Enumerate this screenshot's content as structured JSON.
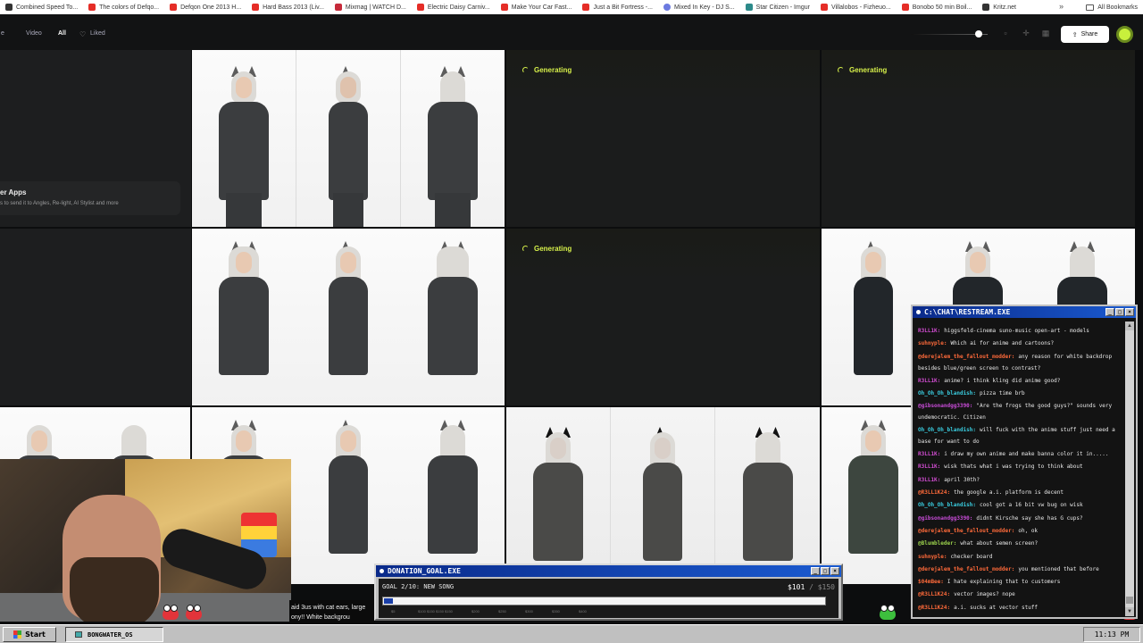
{
  "bookmarks": [
    {
      "label": "Combined Speed To...",
      "icon": "generic-icon"
    },
    {
      "label": "The colors of Defqo...",
      "icon": "youtube-icon"
    },
    {
      "label": "Defqon One 2013 H...",
      "icon": "youtube-icon"
    },
    {
      "label": "Hard Bass 2013 (Liv...",
      "icon": "youtube-icon"
    },
    {
      "label": "Mixmag | WATCH D...",
      "icon": "mixmag-icon"
    },
    {
      "label": "Electric Daisy Carniv...",
      "icon": "youtube-icon"
    },
    {
      "label": "Make Your Car Fast...",
      "icon": "youtube-icon"
    },
    {
      "label": "Just a Bit Fortress -...",
      "icon": "youtube-icon"
    },
    {
      "label": "Mixed In Key - DJ S...",
      "icon": "mixedinkey-icon"
    },
    {
      "label": "Star Citizen - Imgur",
      "icon": "imgur-icon"
    },
    {
      "label": "Villalobos - Fizheuo...",
      "icon": "youtube-icon"
    },
    {
      "label": "Bonobo 50 min Boil...",
      "icon": "youtube-icon"
    },
    {
      "label": "Kritz.net",
      "icon": "generic-icon"
    }
  ],
  "bookmarks_more": "»",
  "all_bookmarks": "All Bookmarks",
  "tabs": {
    "partial": "e",
    "video": "Video",
    "all": "All",
    "liked": "Liked"
  },
  "share_label": "Share",
  "generating_label": "Generating",
  "other_apps": {
    "title": "er Apps",
    "subtitle": "s to send it to Angles, Re-light, AI Stylist and more"
  },
  "caption": {
    "line1": "aid 3us with cat ears, large",
    "line2": "ony!! White backgrou"
  },
  "chat": {
    "title": "C:\\CHAT\\RESTREAM.EXE",
    "messages": [
      {
        "user": "R3LL1K:",
        "text": "higgsfeld-cinema suno-music open-art - models",
        "color": "#d04cd0"
      },
      {
        "user": "suhnyple:",
        "text": "Which ai for anime and cartoons?",
        "color": "#ff6a3a"
      },
      {
        "user": "@derejalem_the_fallout_modder:",
        "text": "any reason for white backdrop besides blue/green screen to contrast?",
        "color": "#ff6a3a",
        "wrap": true
      },
      {
        "user": "R3LL1K:",
        "text": "anime? i think kling did anime good?",
        "color": "#d04cd0"
      },
      {
        "user": "Oh_Oh_Oh_blandish:",
        "text": "pizza time brb",
        "color": "#3acde0"
      },
      {
        "user": "@gibsonandgg3390:",
        "text": "\"Are the frogs the good guys?\" sounds very undemocratic. Citizen",
        "color": "#c84cd8",
        "wrap": true
      },
      {
        "user": "Oh_Oh_Oh_blandish:",
        "text": "will fuck with the anime stuff just need a base for want to do",
        "color": "#3acde0",
        "wrap": true
      },
      {
        "user": "R3LL1K:",
        "text": "i draw my own anime and make banna color it in.....",
        "color": "#d04cd0"
      },
      {
        "user": "R3LL1K:",
        "text": "wisk thats what i was trying to think about",
        "color": "#d04cd0"
      },
      {
        "user": "R3LL1K:",
        "text": "april 30th?",
        "color": "#d04cd0"
      },
      {
        "user": "@R3LL1K24:",
        "text": "the google a.i. platform is decent",
        "color": "#ff6a3a"
      },
      {
        "user": "Oh_Oh_Oh_blandish:",
        "text": "cool got a 16 bit vw bug on wisk",
        "color": "#3acde0"
      },
      {
        "user": "@gibsonandgg3390:",
        "text": "didnt Kirsche say she has G cups?",
        "color": "#c84cd8"
      },
      {
        "user": "@derejalem_the_fallout_modder:",
        "text": "oh, ok",
        "color": "#ff6a3a"
      },
      {
        "user": "@Blumbleder:",
        "text": "what about semen screen?",
        "color": "#9ad04c"
      },
      {
        "user": "suhnyple:",
        "text": "checker board",
        "color": "#ff6a3a"
      },
      {
        "user": "@derejalem_the_fallout_modder:",
        "text": "you mentioned that before",
        "color": "#ff6a3a"
      },
      {
        "user": "$04mBee:",
        "text": "I hate explaining that to customers",
        "color": "#ff6a3a"
      },
      {
        "user": "@R3LL1K24:",
        "text": "vector images? nope",
        "color": "#ff6a3a"
      },
      {
        "user": "@R3LL1K24:",
        "text": "a.i. sucks at vector stuff",
        "color": "#ff6a3a"
      }
    ]
  },
  "donation": {
    "title": "DONATION_GOAL.EXE",
    "goal_text": "GOAL 2/10: NEW SONG",
    "amount": "$101",
    "max": "$150",
    "progress": 0.02,
    "ticks": [
      "$5",
      "$100 $150 $150",
      "$150",
      "$200",
      "$250",
      "$300",
      "$350",
      "$400"
    ]
  },
  "taskbar": {
    "start": "Start",
    "task": "BONGWATER_OS",
    "clock": "11:13 PM"
  }
}
